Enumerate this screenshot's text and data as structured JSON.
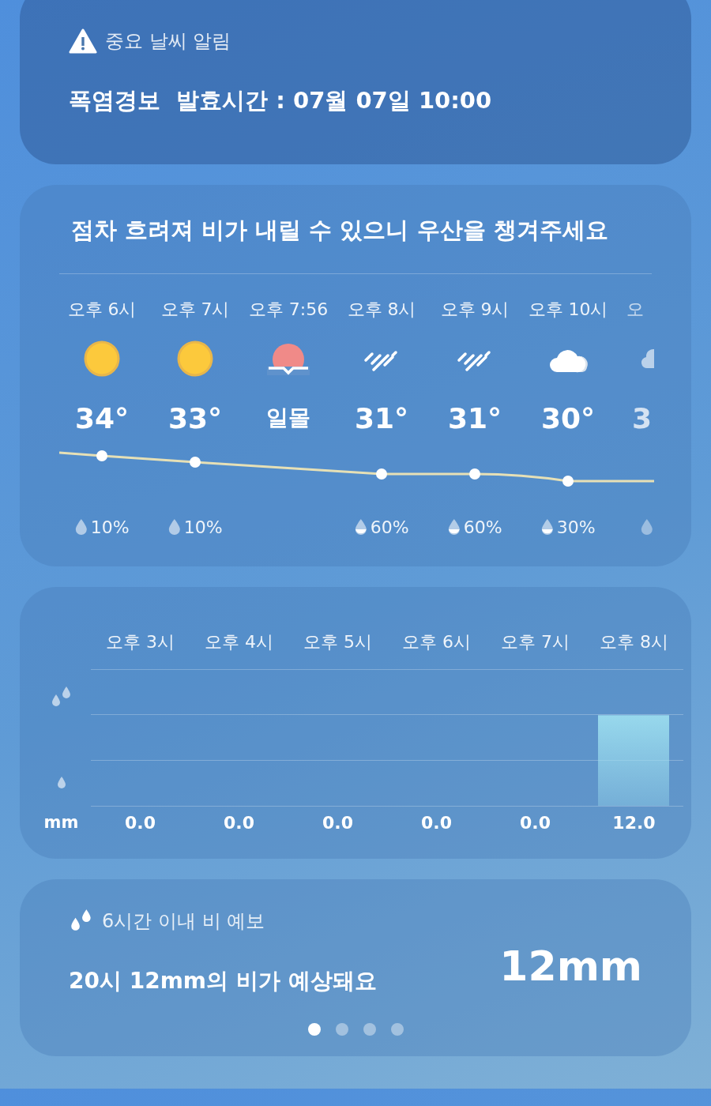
{
  "alert": {
    "title": "중요 날씨 알림",
    "headline": "폭염경보  발효시간 : 07월 07일 10:00"
  },
  "hourly": {
    "summary": "점차 흐려져 비가 내릴 수 있으니 우산을 챙겨주세요",
    "items": [
      {
        "time": "오후 6시",
        "kind": "sun",
        "temp": "34°",
        "precip": "10%",
        "drop_filled": false
      },
      {
        "time": "오후 7시",
        "kind": "sun",
        "temp": "33°",
        "precip": "10%",
        "drop_filled": false
      },
      {
        "time": "오후 7:56",
        "kind": "sunset",
        "temp": "일몰"
      },
      {
        "time": "오후 8시",
        "kind": "rain",
        "temp": "31°",
        "precip": "60%",
        "drop_filled": true
      },
      {
        "time": "오후 9시",
        "kind": "rain",
        "temp": "31°",
        "precip": "60%",
        "drop_filled": true
      },
      {
        "time": "오후 10시",
        "kind": "cloud",
        "temp": "30°",
        "precip": "30%",
        "drop_filled": true
      },
      {
        "time": "오",
        "kind": "cloud-rain",
        "temp": "3",
        "drop_filled": false
      }
    ]
  },
  "rain_chart": {
    "unit": "mm",
    "chart_data": {
      "type": "bar",
      "categories": [
        "오후 3시",
        "오후 4시",
        "오후 5시",
        "오후 6시",
        "오후 7시",
        "오후 8시"
      ],
      "values": [
        0,
        0,
        0,
        0,
        0,
        12
      ],
      "value_labels": [
        "0.0",
        "0.0",
        "0.0",
        "0.0",
        "0.0",
        "12.0"
      ],
      "ylim": [
        0,
        18
      ]
    }
  },
  "rain_forecast": {
    "title": "6시간 이내 비 예보",
    "message": "20시 12mm의 비가 예상돼요",
    "amount": "12mm",
    "pages": [
      {
        "selected": true
      },
      {
        "selected": false
      },
      {
        "selected": false
      },
      {
        "selected": false
      }
    ]
  }
}
